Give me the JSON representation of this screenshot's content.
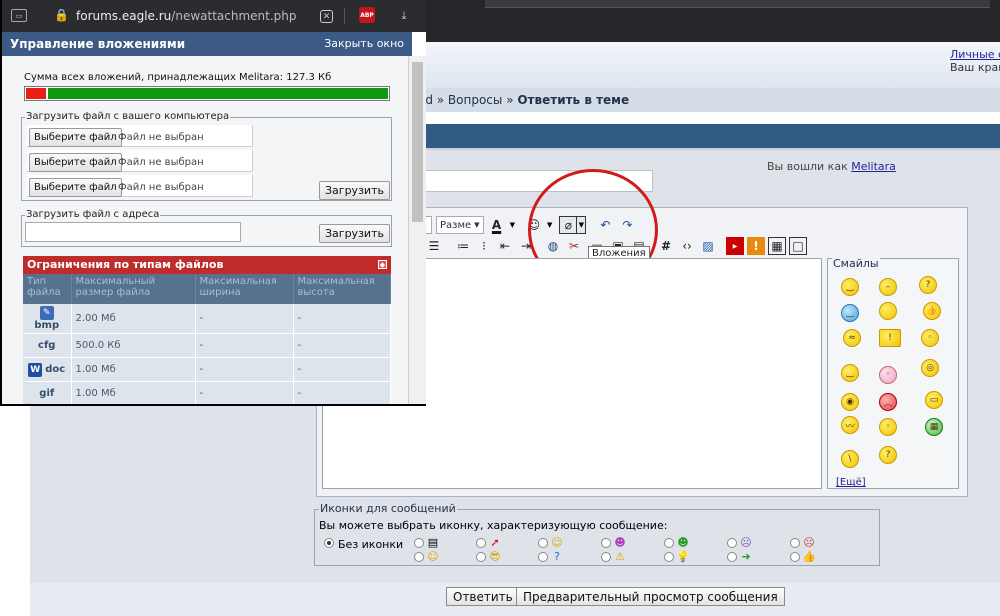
{
  "popup": {
    "url_host": "forums.eagle.ru",
    "url_path": "/newattachment.php",
    "title": "Управление вложениями",
    "close_window": "Закрыть окно",
    "sum_text": "Сумма всех вложений, принадлежащих Melitara: 127.3 Кб",
    "usage_fraction": 0.055,
    "upload_computer_legend": "Загрузить файл с вашего компьютера",
    "choose_file_label": "Выберите файл",
    "no_file_label": "Файл не выбран",
    "upload_label": "Загрузить",
    "upload_url_legend": "Загрузить файл с адреса",
    "limits_title": "Ограничения по типам файлов",
    "limits_headers": [
      "Тип файла",
      "Максимальный размер файла",
      "Максимальная ширина",
      "Максимальная высота"
    ],
    "limits_rows": [
      {
        "ext": "bmp",
        "size": "2.00 Мб",
        "width": "-",
        "height": "-"
      },
      {
        "ext": "cfg",
        "size": "500.0 Кб",
        "width": "-",
        "height": "-"
      },
      {
        "ext": "doc",
        "size": "1.00 Мб",
        "width": "-",
        "height": "-"
      },
      {
        "ext": "gif",
        "size": "1.00 Мб",
        "width": "-",
        "height": "-"
      }
    ],
    "abp_label": "ABP"
  },
  "forum": {
    "user_cp_link": "Личные с",
    "user_cp_sub": "Ваш край",
    "breadcrumb": "ld » Вопросы » ",
    "breadcrumb_current": "Ответить в теме",
    "logged_in_prefix": "Вы вошли как ",
    "username": "Melitara",
    "size_select": "Разме",
    "attach_tooltip": "Вложения",
    "smilies_legend": "Смайлы",
    "more_smilies": "[Ещё]",
    "icons_legend": "Иконки для сообщений",
    "icons_desc": "Вы можете выбрать иконку, характеризующую сообщение:",
    "no_icon": "Без иконки",
    "reply_button": "Ответить",
    "preview_button": "Предварительный просмотр сообщения"
  }
}
